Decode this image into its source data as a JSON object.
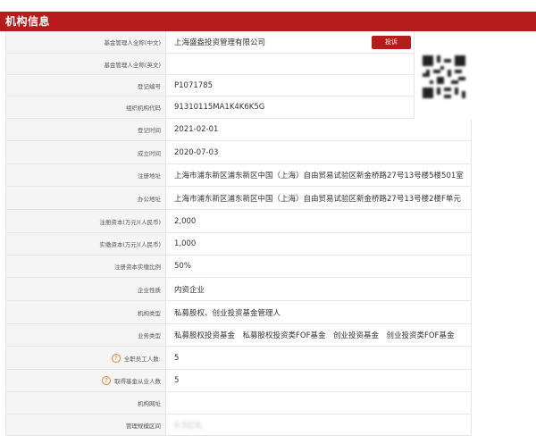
{
  "header": {
    "title": "机构信息"
  },
  "actions": {
    "report_label": "投诉"
  },
  "qr": {
    "icon": "qr-code-icon"
  },
  "colors": {
    "accent": "#b71c1c",
    "label_bg": "#f5f5f5",
    "border": "#e6e6e6"
  },
  "rows": [
    {
      "label": "基金管理人全称(中文)",
      "value": "上海盛盎投资管理有限公司"
    },
    {
      "label": "基金管理人全称(英文)",
      "value": ""
    },
    {
      "label": "登记编号",
      "value": "P1071785"
    },
    {
      "label": "组织机构代码",
      "value": "91310115MA1K4K6K5G"
    },
    {
      "label": "登记时间",
      "value": "2021-02-01"
    },
    {
      "label": "成立时间",
      "value": "2020-07-03"
    },
    {
      "label": "注册地址",
      "value": "上海市浦东新区浦东新区中国（上海）自由贸易试验区新金桥路27号13号楼5楼501室"
    },
    {
      "label": "办公地址",
      "value": "上海市浦东新区浦东新区中国（上海）自由贸易试验区新金桥路27号13号楼2楼F单元"
    },
    {
      "label": "注册资本(万元)(人民币)",
      "value": "2,000"
    },
    {
      "label": "实缴资本(万元)(人民币)",
      "value": "1,000"
    },
    {
      "label": "注册资本实缴比例",
      "value": "50%"
    },
    {
      "label": "企业性质",
      "value": "内资企业"
    },
    {
      "label": "机构类型",
      "value": "私募股权、创业投资基金管理人"
    },
    {
      "label": "业务类型",
      "value": "私募股权投资基金　私募股权投资类FOF基金　创业投资基金　创业投资类FOF基金"
    },
    {
      "label": "全职员工人数:",
      "value": "5"
    },
    {
      "label": "取得基金从业人数",
      "value": "5"
    },
    {
      "label": "机构网址",
      "value": ""
    },
    {
      "label": "管理规模区间",
      "value": "0-5亿元"
    }
  ]
}
